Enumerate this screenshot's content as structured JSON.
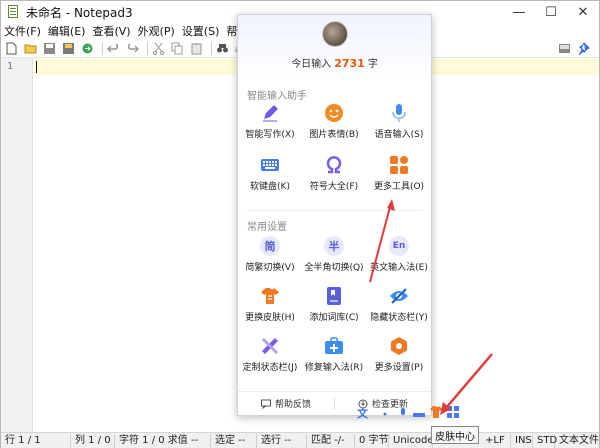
{
  "window": {
    "title": "未命名 - Notepad3",
    "minimize": "—",
    "maximize": "☐",
    "close": "✕"
  },
  "menu": [
    "文件(F)",
    "编辑(E)",
    "查看(V)",
    "外观(P)",
    "设置(S)",
    "帮助(H)"
  ],
  "toolbar": {
    "icons": [
      "new-file-icon",
      "open-folder-icon",
      "save-icon",
      "save-as-icon",
      "browse-icon",
      "undo-icon",
      "redo-icon",
      "cut-icon",
      "copy-icon",
      "paste-icon",
      "find-icon",
      "replace-icon",
      "pin-icon"
    ]
  },
  "gutter": {
    "line_number": "1"
  },
  "popup": {
    "today_prefix": "今日输入",
    "today_count": "2731",
    "today_suffix": "字",
    "section1_title": "智能输入助手",
    "section1_items": [
      {
        "label": "智能写作(X)",
        "icon": "pen-icon",
        "color": "#6b5ce7"
      },
      {
        "label": "图片表情(B)",
        "icon": "smiley-icon",
        "color": "#f08a24"
      },
      {
        "label": "语音输入(S)",
        "icon": "microphone-icon",
        "color": "#3d8ef0"
      },
      {
        "label": "软键盘(K)",
        "icon": "keyboard-icon",
        "color": "#4a7af0"
      },
      {
        "label": "符号大全(F)",
        "icon": "omega-icon",
        "color": "#7a5ce7"
      },
      {
        "label": "更多工具(O)",
        "icon": "tools-grid-icon",
        "color": "#f07a24"
      }
    ],
    "section2_title": "常用设置",
    "section2_items": [
      {
        "label": "简繁切换(V)",
        "glyph": "简",
        "icon": "simplified-traditional-icon"
      },
      {
        "label": "全半角切换(Q)",
        "glyph": "半",
        "icon": "half-width-icon"
      },
      {
        "label": "英文输入法(E)",
        "glyph": "En",
        "icon": "english-input-icon"
      },
      {
        "label": "更换皮肤(H)",
        "icon": "skin-shirt-icon",
        "color": "#f07a24"
      },
      {
        "label": "添加词库(C)",
        "icon": "dictionary-icon",
        "color": "#5a5fd8"
      },
      {
        "label": "隐藏状态栏(Y)",
        "icon": "hide-eye-icon",
        "color": "#3d8ef0"
      },
      {
        "label": "定制状态栏(J)",
        "icon": "customize-ruler-icon",
        "color": "#7a5ce7"
      },
      {
        "label": "修复输入法(R)",
        "icon": "repair-kit-icon",
        "color": "#3d8ef0"
      },
      {
        "label": "更多设置(P)",
        "icon": "settings-hex-icon",
        "color": "#f07a24"
      }
    ],
    "feedback": "帮助反馈",
    "update": "检查更新"
  },
  "tooltip": "皮肤中心",
  "status": {
    "row": "行 1 / 1",
    "col": "列 1 / 0",
    "char": "字符 1 / 0 求值 --",
    "sel": "选定 --",
    "selline": "选行 --",
    "match": "匹配 -/-",
    "bytes": "0 字节",
    "encoding": "Unicode",
    "eol": "+LF",
    "ins": "INS",
    "std": "STD",
    "mode": "文本文件"
  },
  "colors": {
    "accent_orange": "#e8580c",
    "arrow_red": "#e23b3b",
    "current_line": "#fffbd9"
  }
}
